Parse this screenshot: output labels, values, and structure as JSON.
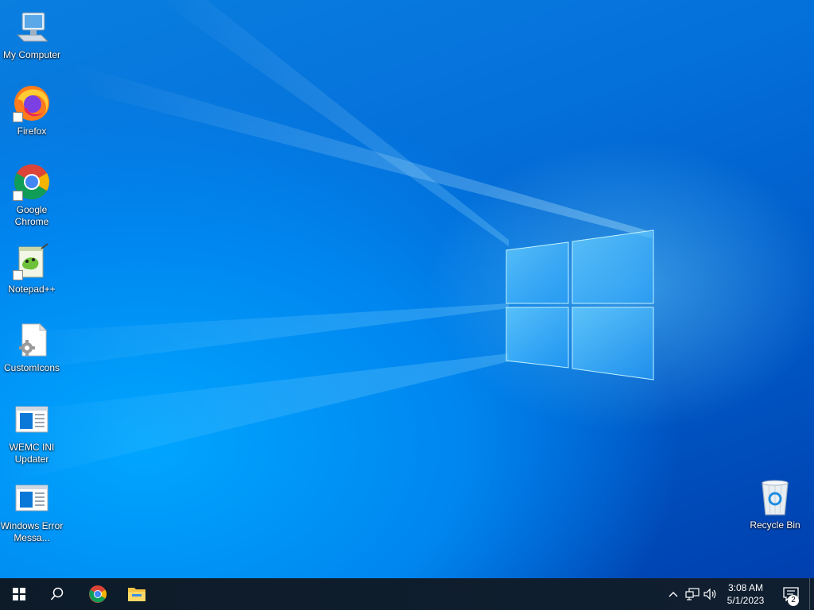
{
  "desktop": {
    "icons": [
      {
        "label": "My Computer",
        "icon": "computer-icon"
      },
      {
        "label": "Firefox",
        "icon": "firefox-icon"
      },
      {
        "label": "Google Chrome",
        "icon": "chrome-icon"
      },
      {
        "label": "Notepad++",
        "icon": "notepadpp-icon"
      },
      {
        "label": "CustomIcons",
        "icon": "settings-file-icon"
      },
      {
        "label": "WEMC INI Updater",
        "icon": "window-app-icon"
      },
      {
        "label": "Windows Error Messa...",
        "icon": "window-app-icon"
      },
      {
        "label": "Recycle Bin",
        "icon": "recycle-bin-icon"
      }
    ]
  },
  "taskbar": {
    "start": "windows-start-icon",
    "search": "search-icon",
    "pinned": [
      "chrome-icon",
      "file-explorer-icon"
    ],
    "tray": [
      "chevron-up-icon",
      "network-icon",
      "volume-icon"
    ],
    "clock": {
      "time": "3:08 AM",
      "date": "5/1/2023"
    },
    "notifications": {
      "count": "2"
    }
  },
  "colors": {
    "taskbar": "#0d1b29",
    "desktop_blue": "#0470da",
    "accent": "#00a6ff"
  }
}
